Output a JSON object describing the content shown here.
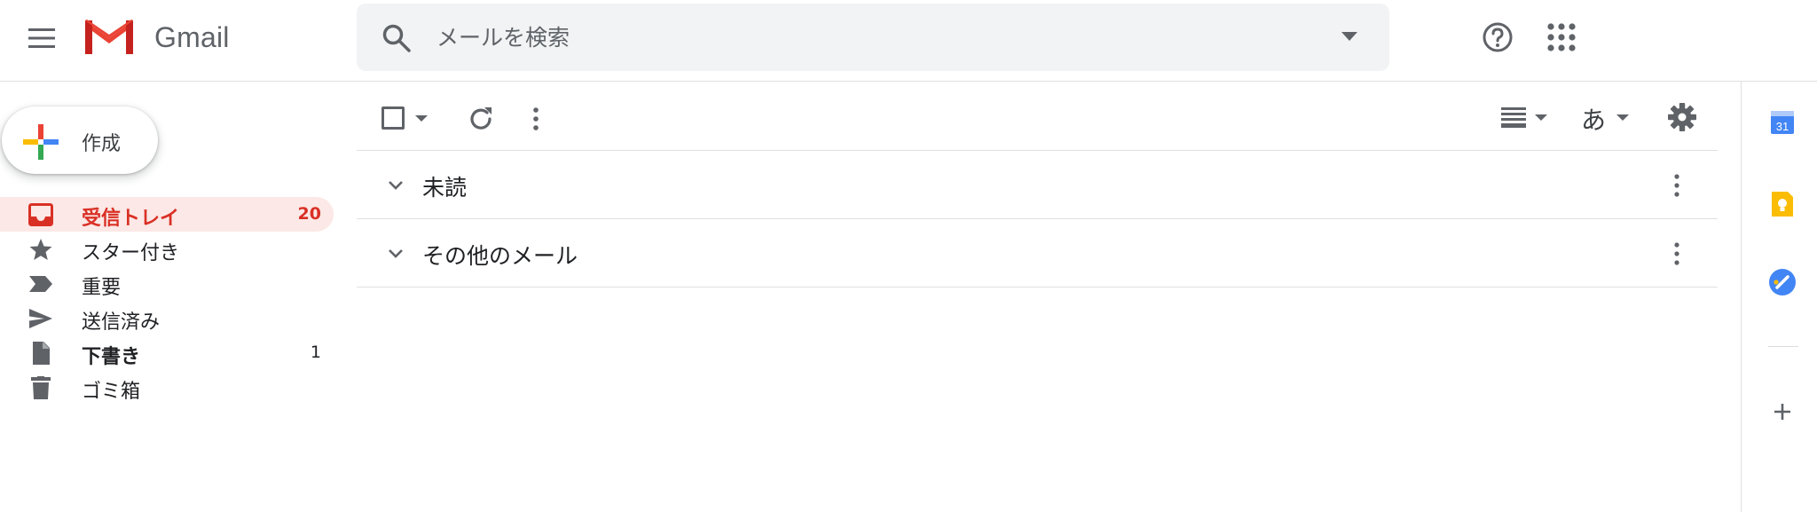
{
  "app": {
    "logo_text": "Gmail"
  },
  "search": {
    "placeholder": "メールを検索"
  },
  "compose": {
    "label": "作成"
  },
  "sidebar": {
    "items": [
      {
        "label": "受信トレイ",
        "count": "20",
        "icon": "inbox-icon"
      },
      {
        "label": "スター付き",
        "count": "",
        "icon": "star-icon"
      },
      {
        "label": "重要",
        "count": "",
        "icon": "important-icon"
      },
      {
        "label": "送信済み",
        "count": "",
        "icon": "send-icon"
      },
      {
        "label": "下書き",
        "count": "1",
        "icon": "draft-icon"
      },
      {
        "label": "ゴミ箱",
        "count": "",
        "icon": "trash-icon"
      }
    ]
  },
  "toolbar": {
    "ime_label": "あ"
  },
  "sections": [
    {
      "title": "未読"
    },
    {
      "title": "その他のメール"
    }
  ],
  "side_panel": {
    "calendar_day": "31"
  },
  "colors": {
    "accent_red": "#d93025",
    "active_bg": "#fce8e6",
    "icon_gray": "#5f6368"
  }
}
